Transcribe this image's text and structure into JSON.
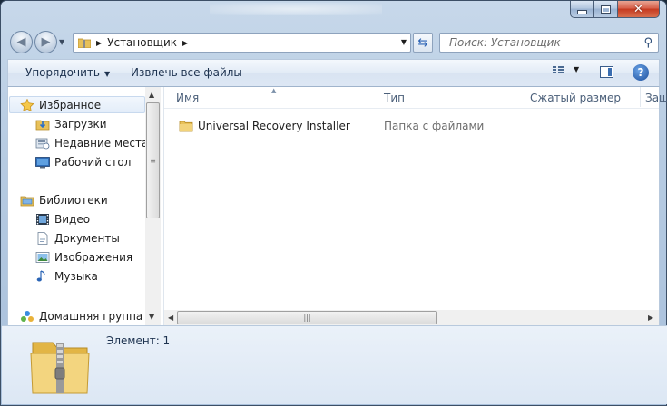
{
  "address_bar": {
    "segments": [
      "Установщик"
    ]
  },
  "search": {
    "placeholder": "Поиск: Установщик"
  },
  "toolbar": {
    "organize_label": "Упорядочить",
    "extract_label": "Извлечь все файлы"
  },
  "nav": {
    "favorites": {
      "label": "Избранное",
      "icon": "star-icon"
    },
    "favorites_items": [
      {
        "label": "Загрузки",
        "icon": "downloads-icon"
      },
      {
        "label": "Недавние места",
        "icon": "recent-places-icon"
      },
      {
        "label": "Рабочий стол",
        "icon": "desktop-icon"
      }
    ],
    "libraries": {
      "label": "Библиотеки",
      "icon": "libraries-icon"
    },
    "libraries_items": [
      {
        "label": "Видео",
        "icon": "video-icon"
      },
      {
        "label": "Документы",
        "icon": "documents-icon"
      },
      {
        "label": "Изображения",
        "icon": "pictures-icon"
      },
      {
        "label": "Музыка",
        "icon": "music-icon"
      }
    ],
    "homegroup": {
      "label": "Домашняя группа",
      "icon": "homegroup-icon"
    }
  },
  "columns": [
    "Имя",
    "Тип",
    "Сжатый размер",
    "Защ"
  ],
  "files": [
    {
      "name": "Universal Recovery Installer",
      "type": "Папка с файлами",
      "icon": "folder-icon"
    }
  ],
  "details": {
    "item_count": "Элемент: 1"
  },
  "colors": {
    "accent": "#2b63b5",
    "folder": "#e8c15a"
  }
}
